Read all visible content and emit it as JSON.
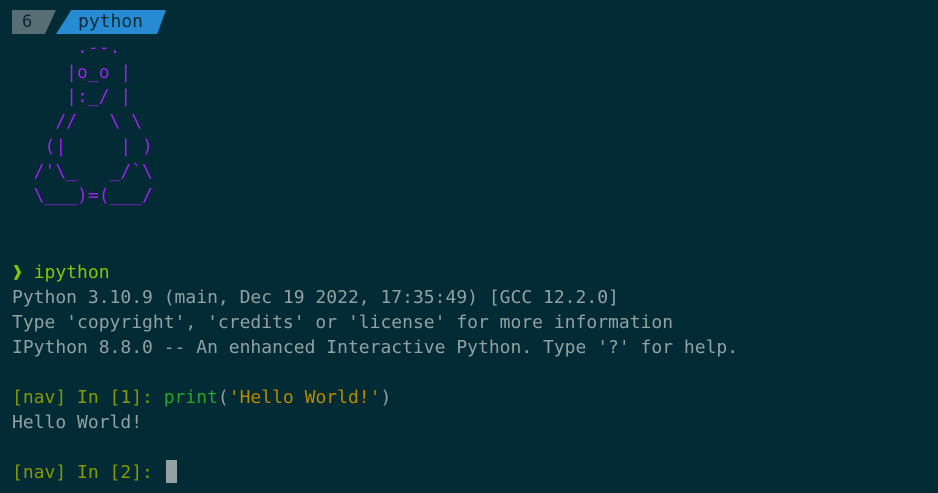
{
  "tabs": {
    "number": "6",
    "active_label": "python"
  },
  "ascii_art": "      .--.\n     |o_o |\n     |:_/ |\n    //   \\ \\\n   (|     | )\n  /'\\_   _/`\\\n  \\___)=(___/",
  "terminal": {
    "chevron": "❱",
    "command": "ipython",
    "banner": [
      "Python 3.10.9 (main, Dec 19 2022, 17:35:49) [GCC 12.2.0]",
      "Type 'copyright', 'credits' or 'license' for more information",
      "IPython 8.8.0 -- An enhanced Interactive Python. Type '?' for help."
    ],
    "prompt1": "[nav] In [1]: ",
    "input1_fn": "print",
    "input1_open": "(",
    "input1_str": "'Hello World!'",
    "input1_close": ")",
    "output1": "Hello World!",
    "prompt2": "[nav] In [2]: "
  },
  "colors": {
    "background": "#022b36",
    "text": "#93a1a1",
    "art": "#a020f0",
    "prompt": "#859900",
    "function": "#2aa32a",
    "string": "#b58900",
    "tab_active": "#268bd2",
    "tab_number": "#586e75"
  }
}
